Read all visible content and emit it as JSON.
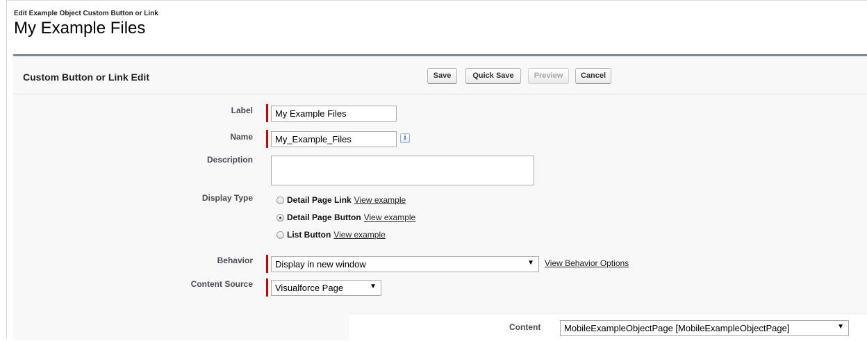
{
  "header": {
    "breadcrumb": "Edit Example Object Custom Button or Link",
    "title": "My Example Files"
  },
  "panel": {
    "title": "Custom Button or Link Edit",
    "buttons": {
      "save": "Save",
      "quick_save": "Quick Save",
      "preview": "Preview",
      "cancel": "Cancel"
    }
  },
  "form": {
    "label": {
      "label": "Label",
      "value": "My Example Files"
    },
    "name": {
      "label": "Name",
      "value": "My_Example_Files",
      "icon": "info-icon"
    },
    "description": {
      "label": "Description",
      "value": ""
    },
    "display_type": {
      "label": "Display Type",
      "options": [
        {
          "label": "Detail Page Link",
          "link": "View example",
          "checked": false
        },
        {
          "label": "Detail Page Button",
          "link": "View example",
          "checked": true
        },
        {
          "label": "List Button",
          "link": "View example",
          "checked": false
        }
      ]
    },
    "behavior": {
      "label": "Behavior",
      "value": "Display in new window",
      "link": "View Behavior Options"
    },
    "content_source": {
      "label": "Content Source",
      "value": "Visualforce Page"
    },
    "content": {
      "label": "Content",
      "value": "MobileExampleObjectPage [MobileExampleObjectPage]"
    }
  },
  "colors": {
    "required_bar": "#cc0000",
    "panel_border": "#7d8a99",
    "panel_bg": "#f8f8f8"
  }
}
